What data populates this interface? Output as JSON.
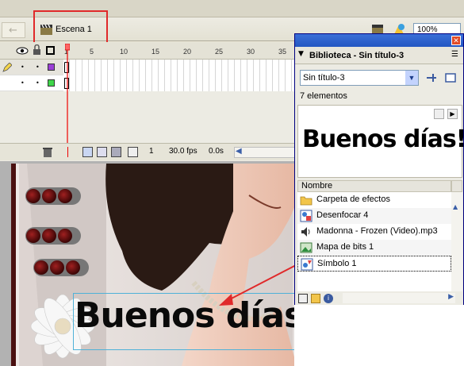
{
  "toolbar": {
    "scene_label": "Escena 1",
    "zoom_value": "100%"
  },
  "timeline": {
    "frame_numbers": [
      "1",
      "5",
      "10",
      "15",
      "20",
      "25",
      "30",
      "35"
    ],
    "current_frame": "1",
    "fps": "30.0 fps",
    "elapsed": "0.0s"
  },
  "stage": {
    "text": "Buenos días!!!"
  },
  "library": {
    "title": "Biblioteca - Sin título-3",
    "document_select": "Sin título-3",
    "count": "7 elementos",
    "preview_text": "Buenos días!!!",
    "column_header": "Nombre",
    "items": [
      {
        "label": "Carpeta de efectos",
        "icon": "folder-icon"
      },
      {
        "label": "Desenfocar 4",
        "icon": "movieclip-icon"
      },
      {
        "label": "Madonna - Frozen (Video).mp3",
        "icon": "sound-icon"
      },
      {
        "label": "Mapa de bits 1",
        "icon": "bitmap-icon"
      },
      {
        "label": "Símbolo 1",
        "icon": "graphic-icon"
      }
    ]
  },
  "colors": {
    "annotation_red": "#e0292a",
    "selection_blue": "#4fb1d8",
    "title_bar_blue": "#2357c2"
  }
}
